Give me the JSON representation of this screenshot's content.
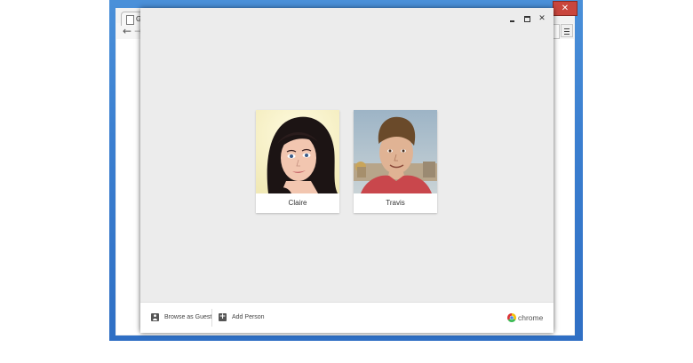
{
  "browser": {
    "tab_title": "Go",
    "back_glyph": "←",
    "forward_glyph": "→",
    "close_glyph": "✕",
    "menu_icon": "hamburger-icon"
  },
  "dialog": {
    "minimize_icon": "minimize-icon",
    "maximize_icon": "maximize-icon",
    "close_glyph": "✕",
    "background_color": "#ececec"
  },
  "profiles": [
    {
      "name": "Claire",
      "avatar": "avatar-photo-woman"
    },
    {
      "name": "Travis",
      "avatar": "avatar-photo-man"
    }
  ],
  "footer": {
    "guest_label": "Browse as Guest",
    "guest_icon": "person-icon",
    "add_label": "Add Person",
    "add_icon": "add-box-icon",
    "add_glyph": "+",
    "brand_text": "chrome",
    "brand_icon": "chrome-logo-icon"
  },
  "colors": {
    "windows_frame": "#3b7fd0",
    "close_red": "#c9463d",
    "footer_bg": "#ffffff"
  }
}
